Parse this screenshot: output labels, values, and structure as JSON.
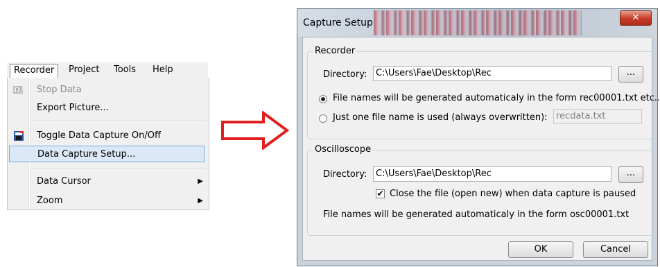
{
  "menubar": {
    "items": [
      "Recorder",
      "Project",
      "Tools",
      "Help"
    ]
  },
  "recorder_menu": {
    "items": [
      {
        "label": "Stop Data",
        "icon": "stop-data-icon"
      },
      {
        "label": "Export Picture..."
      },
      {
        "label": "Toggle Data Capture On/Off",
        "icon": "data-capture-icon"
      },
      {
        "label": "Data Capture Setup..."
      },
      {
        "label": "Data Cursor"
      },
      {
        "label": "Zoom"
      }
    ]
  },
  "dialog": {
    "title": "Capture Setup",
    "close_glyph": "✕",
    "recorder": {
      "group_title": "Recorder",
      "directory_label": "Directory:",
      "directory_value": "C:\\Users\\Fae\\Desktop\\Rec",
      "browse_label": "...",
      "option_auto": "File names will be generated automaticaly in the form rec00001.txt etc..",
      "option_single": "Just one file name is used (always overwritten):",
      "single_filename": "recdata.txt"
    },
    "oscilloscope": {
      "group_title": "Oscilloscope",
      "directory_label": "Directory:",
      "directory_value": "C:\\Users\\Fae\\Desktop\\Rec",
      "browse_label": "...",
      "close_file_label": "Close the file (open new) when data capture is paused",
      "close_file_checked": "✔",
      "info": "File names will be generated automaticaly in the form osc00001.txt"
    },
    "ok_label": "OK",
    "cancel_label": "Cancel"
  },
  "colors": {
    "arrow": "#e02020",
    "highlight": "#dbe8f7",
    "close_button": "#c8402a"
  }
}
